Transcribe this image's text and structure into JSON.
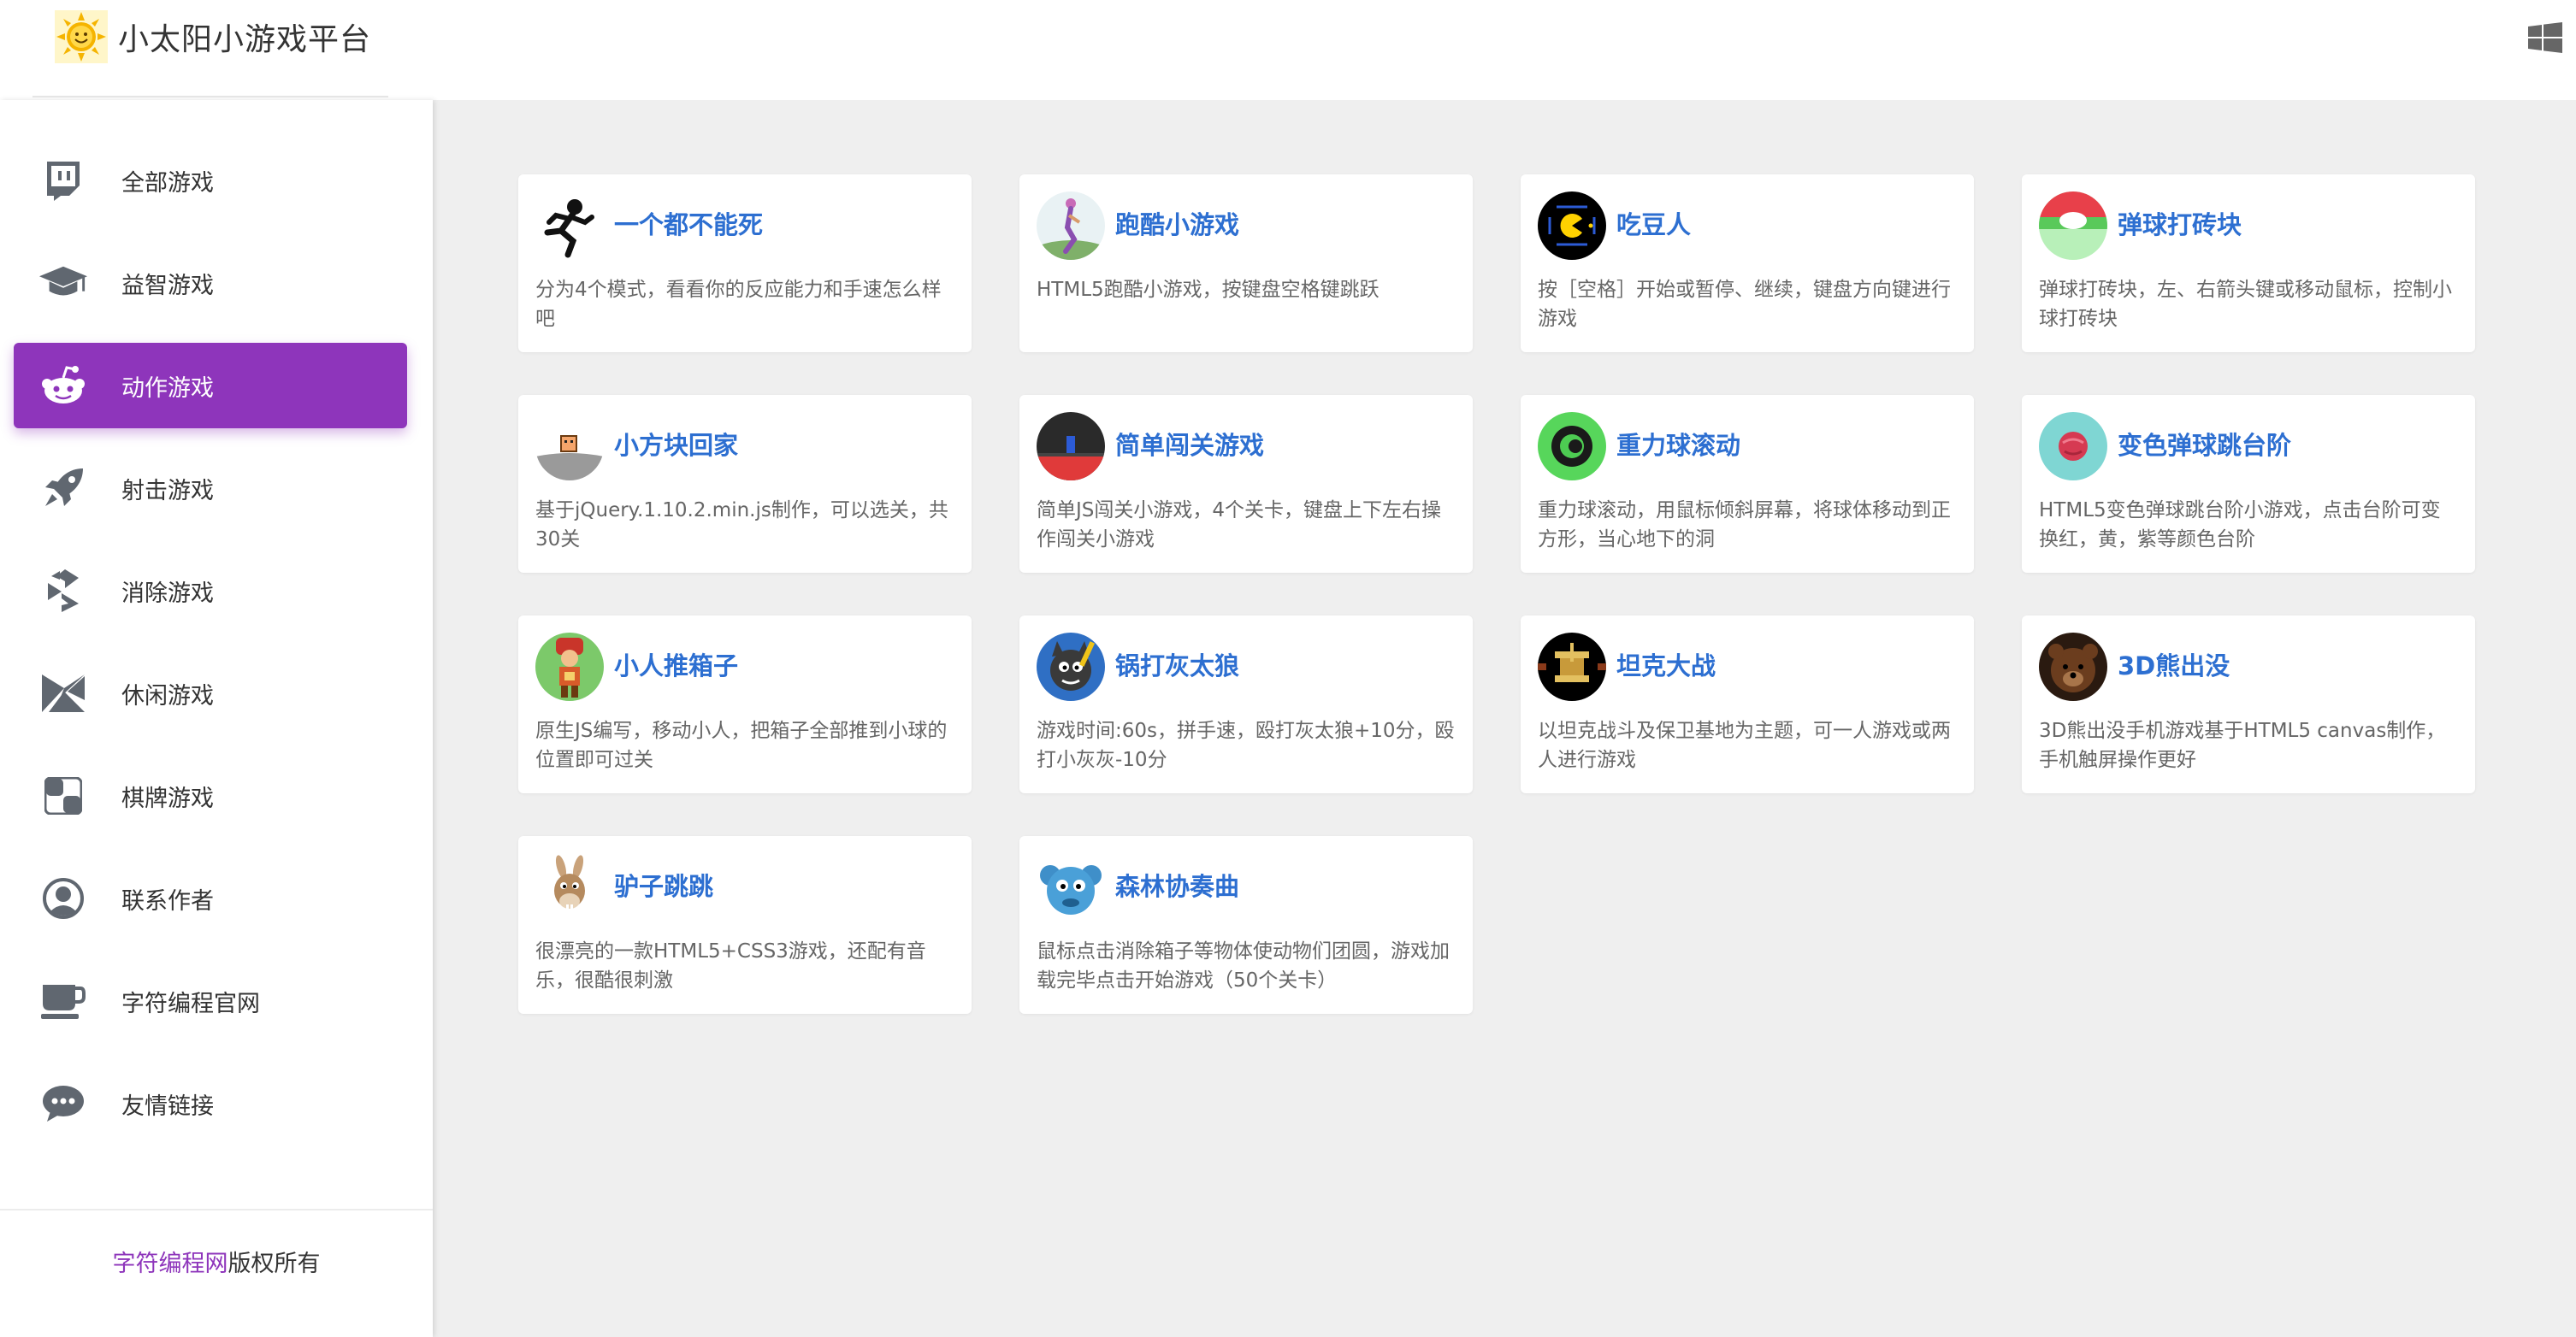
{
  "header": {
    "title": "小太阳小游戏平台",
    "logo_icon": "sun-logo-icon",
    "window_icon": "windows-icon"
  },
  "sidebar": {
    "items": [
      {
        "label": "全部游戏",
        "icon": "twitch-icon",
        "active": false
      },
      {
        "label": "益智游戏",
        "icon": "graduation-cap-icon",
        "active": false
      },
      {
        "label": "动作游戏",
        "icon": "reddit-icon",
        "active": true
      },
      {
        "label": "射击游戏",
        "icon": "rocket-icon",
        "active": false
      },
      {
        "label": "消除游戏",
        "icon": "symfony-icon",
        "active": false
      },
      {
        "label": "休闲游戏",
        "icon": "origami-icon",
        "active": false
      },
      {
        "label": "棋牌游戏",
        "icon": "chess-board-icon",
        "active": false
      },
      {
        "label": "联系作者",
        "icon": "user-circle-icon",
        "active": false
      },
      {
        "label": "字符编程官网",
        "icon": "coffee-cup-icon",
        "active": false
      },
      {
        "label": "友情链接",
        "icon": "chat-bubble-icon",
        "active": false
      }
    ],
    "footer_link": "字符编程网",
    "footer_text": "版权所有"
  },
  "colors": {
    "accent": "#8e35bb",
    "title_blue": "#2d6fd1",
    "desc_gray": "#666666",
    "background": "#efefef"
  },
  "games": [
    {
      "title": "一个都不能死",
      "desc": "分为4个模式，看看你的反应能力和手速怎么样吧",
      "thumb": "running-stickman-icon"
    },
    {
      "title": "跑酷小游戏",
      "desc": "HTML5跑酷小游戏，按键盘空格键跳跃",
      "thumb": "parkour-runner-icon"
    },
    {
      "title": "吃豆人",
      "desc": "按［空格］开始或暂停、继续，键盘方向键进行游戏",
      "thumb": "pacman-icon"
    },
    {
      "title": "弹球打砖块",
      "desc": "弹球打砖块，左、右箭头键或移动鼠标，控制小球打砖块",
      "thumb": "brick-ball-icon"
    },
    {
      "title": "小方块回家",
      "desc": "基于jQuery.1.10.2.min.js制作，可以选关，共30关",
      "thumb": "little-block-icon"
    },
    {
      "title": "简单闯关游戏",
      "desc": "简单JS闯关小游戏，4个关卡，键盘上下左右操作闯关小游戏",
      "thumb": "level-block-icon"
    },
    {
      "title": "重力球滚动",
      "desc": "重力球滚动，用鼠标倾斜屏幕，将球体移动到正方形，当心地下的洞",
      "thumb": "gravity-ball-icon"
    },
    {
      "title": "变色弹球跳台阶",
      "desc": "HTML5变色弹球跳台阶小游戏，点击台阶可变换红，黄，紫等颜色台阶",
      "thumb": "color-ball-icon"
    },
    {
      "title": "小人推箱子",
      "desc": "原生JS编写，移动小人，把箱子全部推到小球的位置即可过关",
      "thumb": "sokoban-icon"
    },
    {
      "title": "锅打灰太狼",
      "desc": "游戏时间:60s，拼手速，殴打灰太狼+10分，殴打小灰灰-10分",
      "thumb": "wolf-icon"
    },
    {
      "title": "坦克大战",
      "desc": "以坦克战斗及保卫基地为主题，可一人游戏或两人进行游戏",
      "thumb": "tank-icon"
    },
    {
      "title": "3D熊出没",
      "desc": "3D熊出没手机游戏基于HTML5 canvas制作，手机触屏操作更好",
      "thumb": "bear-icon"
    },
    {
      "title": "驴子跳跳",
      "desc": "很漂亮的一款HTML5+CSS3游戏，还配有音乐，很酷很刺激",
      "thumb": "donkey-icon"
    },
    {
      "title": "森林协奏曲",
      "desc": "鼠标点击消除箱子等物体使动物们团圆，游戏加载完毕点击开始游戏（50个关卡）",
      "thumb": "blue-monster-icon"
    }
  ]
}
